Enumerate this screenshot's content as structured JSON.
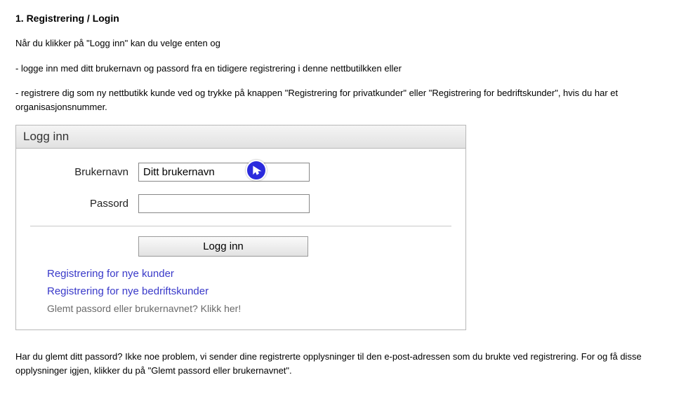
{
  "heading": "1. Registrering / Login",
  "intro": "Når du klikker på \"Logg inn\" kan du velge enten og",
  "bullet1": "- logge inn med ditt brukernavn og passord fra en tidigere registrering i denne nettbutilkken eller",
  "bullet2": "- registrere dig som ny nettbutikk kunde ved og trykke på knappen \"Registrering for privatkunder\" eller \"Registrering for bedriftskunder\", hvis du har et organisasjonsnummer.",
  "panel": {
    "title": "Logg inn",
    "username_label": "Brukernavn",
    "username_value": "Ditt brukernavn",
    "password_label": "Passord",
    "password_value": "",
    "login_button": "Logg inn",
    "link_private": "Registrering for nye kunder",
    "link_business": "Registrering for nye bedriftskunder",
    "link_forgot": "Glemt passord eller brukernavnet? Klikk her!"
  },
  "outro1": "Har du glemt ditt passord? Ikke noe problem, vi sender dine registrerte opplysninger til den e-post-adressen som du brukte ved registrering. For og få disse opplysninger igjen, klikker du på \"Glemt passord eller brukernavnet\"."
}
